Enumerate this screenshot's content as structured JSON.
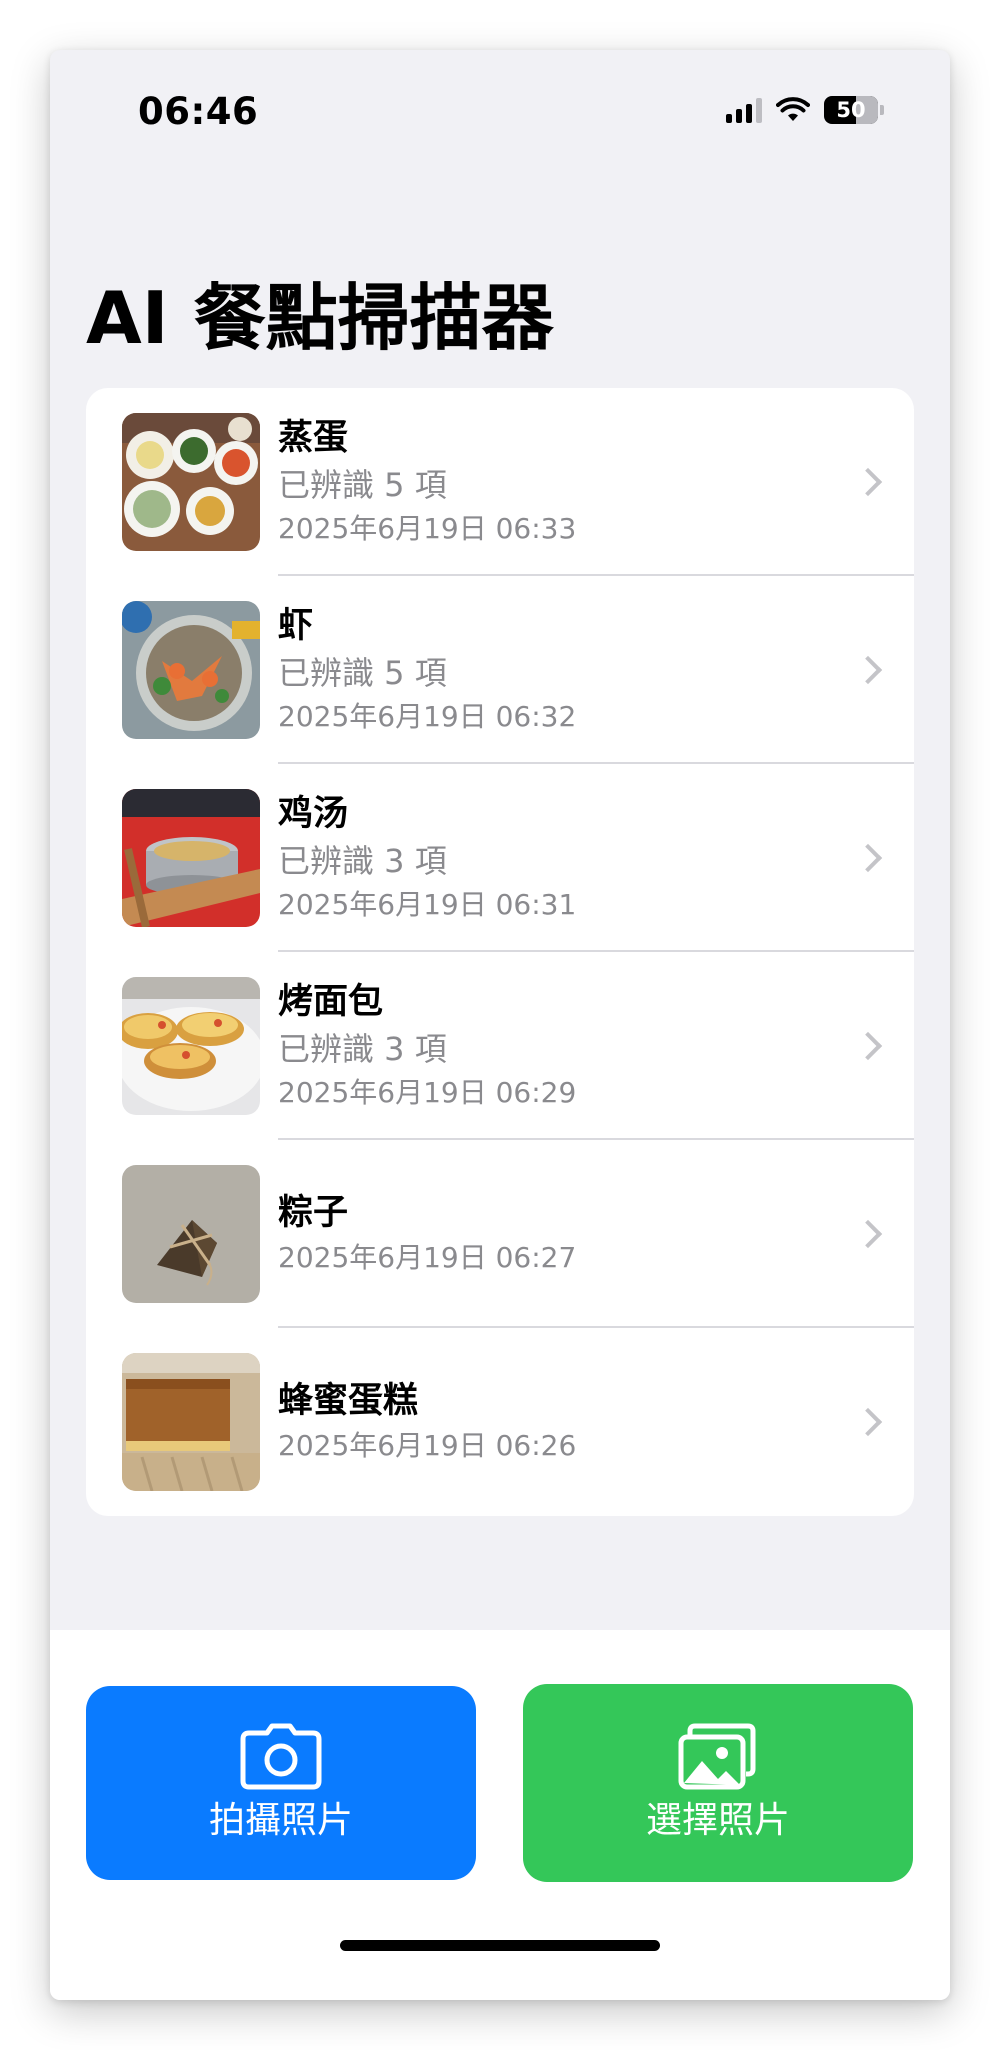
{
  "status_bar": {
    "time": "06:46",
    "battery": "50"
  },
  "page": {
    "title": "AI 餐點掃描器"
  },
  "meals": [
    {
      "title": "蒸蛋",
      "subtitle": "已辨識 5 項",
      "date": "2025年6月19日 06:33",
      "thumb_icon": "meal-photo-icon"
    },
    {
      "title": "虾",
      "subtitle": "已辨識 5 項",
      "date": "2025年6月19日 06:32",
      "thumb_icon": "meal-photo-icon"
    },
    {
      "title": "鸡汤",
      "subtitle": "已辨識 3 項",
      "date": "2025年6月19日 06:31",
      "thumb_icon": "meal-photo-icon"
    },
    {
      "title": "烤面包",
      "subtitle": "已辨識 3 項",
      "date": "2025年6月19日 06:29",
      "thumb_icon": "meal-photo-icon"
    },
    {
      "title": "粽子",
      "date": "2025年6月19日 06:27",
      "thumb_icon": "meal-photo-icon"
    },
    {
      "title": "蜂蜜蛋糕",
      "date": "2025年6月19日 06:26",
      "thumb_icon": "meal-photo-icon"
    }
  ],
  "actions": {
    "camera_label": "拍攝照片",
    "gallery_label": "選擇照片",
    "camera_color": "#0a7bff",
    "gallery_color": "#34c759"
  }
}
